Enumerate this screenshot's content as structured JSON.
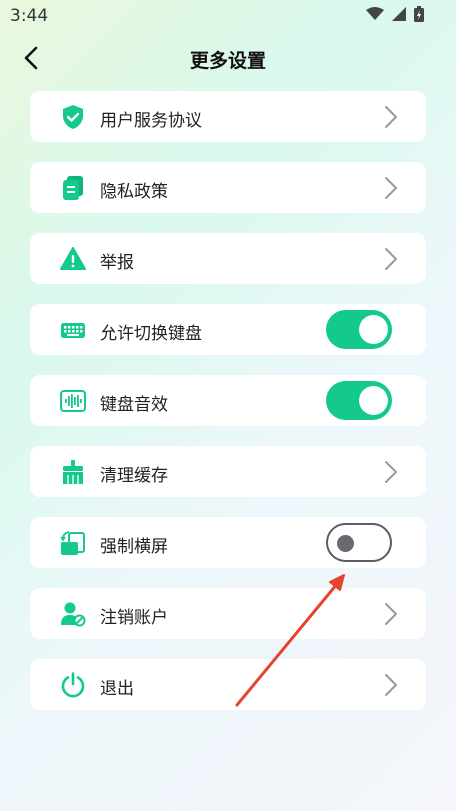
{
  "status": {
    "time": "3:44"
  },
  "header": {
    "title": "更多设置"
  },
  "colors": {
    "accent": "#13c98b",
    "arrow": "#e8412f"
  },
  "items": [
    {
      "label": "用户服务协议",
      "icon": "shield-check-icon",
      "control": "chevron"
    },
    {
      "label": "隐私政策",
      "icon": "document-icon",
      "control": "chevron"
    },
    {
      "label": "举报",
      "icon": "warning-icon",
      "control": "chevron"
    },
    {
      "label": "允许切换键盘",
      "icon": "keyboard-icon",
      "control": "toggle",
      "toggle_on": true
    },
    {
      "label": "键盘音效",
      "icon": "sound-wave-icon",
      "control": "toggle",
      "toggle_on": true
    },
    {
      "label": "清理缓存",
      "icon": "broom-icon",
      "control": "chevron"
    },
    {
      "label": "强制横屏",
      "icon": "rotate-screen-icon",
      "control": "toggle",
      "toggle_on": false
    },
    {
      "label": "注销账户",
      "icon": "user-remove-icon",
      "control": "chevron"
    },
    {
      "label": "退出",
      "icon": "power-icon",
      "control": "chevron"
    }
  ]
}
